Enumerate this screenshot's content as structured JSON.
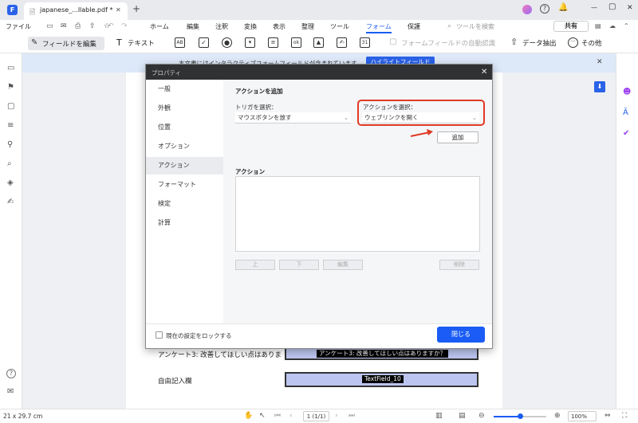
{
  "tab": {
    "title": "japanese_...llable.pdf *",
    "close": "✕",
    "new_tab": "+"
  },
  "window": {
    "minimize": "—",
    "maximize": "▢",
    "close": "✕"
  },
  "menu": {
    "file": "ファイル",
    "items": [
      "ホーム",
      "編集",
      "注釈",
      "変換",
      "表示",
      "整理",
      "ツール",
      "フォーム",
      "保護"
    ],
    "active": "フォーム",
    "search_placeholder": "ツールを検索",
    "share": "共有"
  },
  "toolbar": {
    "edit_fields": "フィールドを編集",
    "text": "テキスト",
    "auto_recognize": "フォームフィールドの自動認識",
    "data_extract": "データ抽出",
    "more": "その他"
  },
  "notice": {
    "text": "本文書にはインタラクティブフォームフィールドが含まれています",
    "highlight_button": "ハイライトフィールド"
  },
  "dialog": {
    "title": "プロパティ",
    "nav": [
      "一般",
      "外観",
      "位置",
      "オプション",
      "アクション",
      "フォーマット",
      "検定",
      "計算"
    ],
    "active_nav": "アクション",
    "add_action_header": "アクションを追加",
    "trigger_label": "トリガを選択：",
    "trigger_value": "マウスボタンを放す",
    "action_label": "アクションを選択：",
    "action_value": "ウェブリンクを開く",
    "add_button": "追加",
    "actions_header": "アクション",
    "up_button": "上",
    "down_button": "下",
    "edit_button": "編集",
    "delete_button": "削除",
    "lock_label": "現在の設定をロックする",
    "close_button": "閉じる"
  },
  "document": {
    "q3_label": "アンケート3: 改善してほしい点はありま",
    "q3_field": "アンケート3: 改善してほしい点はありますか？",
    "free_label": "自由記入欄",
    "free_field": "TextField_10"
  },
  "status": {
    "page_size": "21 x 29.7 cm",
    "page_indicator": "1 (1/1)",
    "zoom": "100%"
  },
  "colors": {
    "accent": "#1a5cf5",
    "highlight_box": "#e03a25",
    "field_fill": "#bcc5f0"
  }
}
